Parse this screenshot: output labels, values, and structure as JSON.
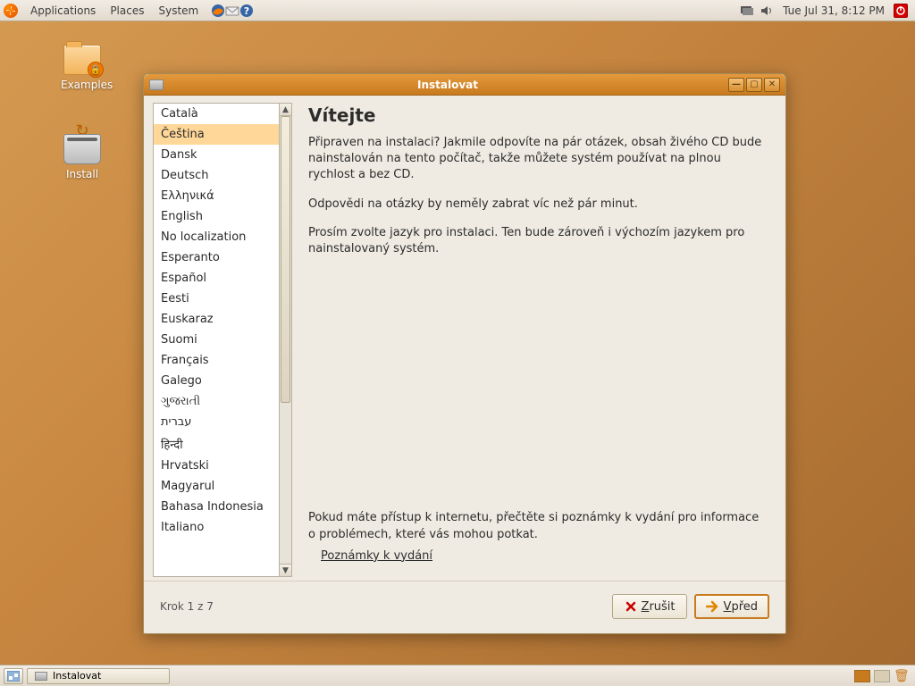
{
  "topbar": {
    "menus": [
      "Applications",
      "Places",
      "System"
    ],
    "clock": "Tue Jul 31,  8:12 PM"
  },
  "desktop": {
    "examples_label": "Examples",
    "install_label": "Install"
  },
  "window": {
    "title": "Instalovat",
    "heading": "Vítejte",
    "para1": "Připraven na instalaci? Jakmile odpovíte na pár otázek, obsah živého CD bude nainstalován na tento počítač, takže můžete systém používat na plnou rychlost a bez CD.",
    "para2": "Odpovědi na otázky by neměly zabrat víc než pár minut.",
    "para3": "Prosím zvolte jazyk pro instalaci. Ten bude zároveň i výchozím jazykem pro nainstalovaný systém.",
    "notes_para": "Pokud máte přístup k internetu, přečtěte si poznámky k vydání pro informace o problémech, které vás mohou potkat.",
    "notes_link": "Poznámky k vydání",
    "step": "Krok 1 z 7",
    "cancel": "Zrušit",
    "forward": "Vpřed",
    "languages": [
      "Català",
      "Čeština",
      "Dansk",
      "Deutsch",
      "Ελληνικά",
      "English",
      "No localization",
      "Esperanto",
      "Español",
      "Eesti",
      "Euskaraz",
      "Suomi",
      "Français",
      "Galego",
      "ગુજરાતી",
      "עברית",
      "हिन्दी",
      "Hrvatski",
      "Magyarul",
      "Bahasa Indonesia",
      "Italiano"
    ],
    "selected_index": 1
  },
  "taskbar": {
    "task_label": "Instalovat"
  }
}
